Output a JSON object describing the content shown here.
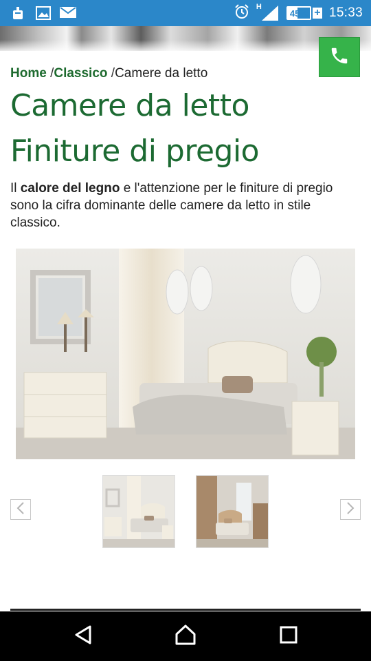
{
  "status_bar": {
    "battery_percent": "45%",
    "battery_level": 0.45,
    "network_type": "H",
    "time": "15:33",
    "notification_icons": [
      "bluetooth-icon",
      "gallery-icon",
      "mail-icon"
    ],
    "system_icons": [
      "alarm-icon",
      "signal-icon",
      "battery-icon",
      "charging-icon"
    ]
  },
  "header": {
    "call_button_icon": "phone-icon",
    "call_button_color": "#36b34a"
  },
  "breadcrumb": {
    "home": "Home",
    "sep1": " /",
    "category": "Classico",
    "sep2": " /",
    "current": "Camere da letto"
  },
  "page": {
    "title": "Camere da letto",
    "subtitle": "Finiture di pregio",
    "intro_before": "Il ",
    "intro_bold": "calore del legno",
    "intro_after": " e l'attenzione per le finiture di pregio sono la cifra dominante delle camere da letto in stile classico."
  },
  "gallery": {
    "main_image": "classic-ivory-bedroom-photo",
    "thumbnails": [
      {
        "image": "classic-ivory-bedroom-thumb",
        "selected": true
      },
      {
        "image": "classic-wood-bedroom-thumb",
        "selected": false
      }
    ],
    "prev_icon": "chevron-left-icon",
    "next_icon": "chevron-right-icon"
  },
  "nav_bar": {
    "buttons": [
      "back-icon",
      "home-icon",
      "recents-icon"
    ]
  },
  "colors": {
    "status_bar": "#2b87c9",
    "heading_green": "#1c6a32",
    "link_green": "#1e6b2f",
    "call_green": "#36b34a"
  }
}
